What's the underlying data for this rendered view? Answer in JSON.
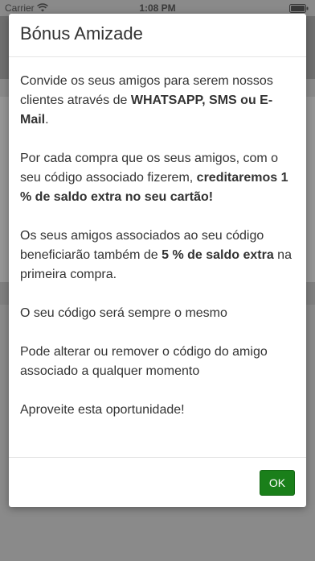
{
  "status_bar": {
    "carrier": "Carrier",
    "time": "1:08 PM"
  },
  "dialog": {
    "title": "Bónus Amizade",
    "p1": {
      "t1": "Convide os seus amigos para serem nossos clientes através de ",
      "b1": "WHATSAPP, SMS ou E-Mail",
      "t2": "."
    },
    "p2": {
      "t1": "Por cada compra que os seus amigos, com o seu código associado fizerem, ",
      "b1": "creditaremos 1 % de saldo extra no seu cartão!"
    },
    "p3": {
      "t1": "Os seus amigos associados ao seu código beneficiarão também de ",
      "b1": "5 % de saldo extra",
      "t2": " na primeira compra."
    },
    "p4": "O seu código será sempre o mesmo",
    "p5": "Pode alterar ou remover o código do amigo associado a qualquer momento",
    "p6": "Aproveite esta oportunidade!",
    "ok_label": "OK"
  },
  "colors": {
    "ok_button": "#1a7f1a",
    "overlay": "#8a8a8a"
  },
  "icons": [
    "wifi-icon",
    "battery-icon",
    "menu-icon"
  ]
}
